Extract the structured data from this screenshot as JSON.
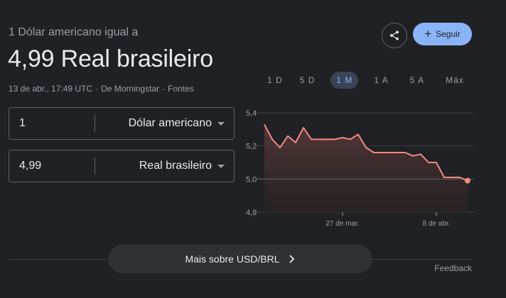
{
  "header": {
    "subtitle": "1 Dólar americano igual a",
    "value": "4,99 Real brasileiro",
    "timestamp": "13 de abr., 17:49 UTC",
    "source": "De Morningstar",
    "sources_link": "Fontes"
  },
  "actions": {
    "share_icon": "share-icon",
    "follow_label": "Seguir"
  },
  "converter": {
    "from": {
      "amount": "1",
      "currency": "Dólar americano"
    },
    "to": {
      "amount": "4,99",
      "currency": "Real brasileiro"
    }
  },
  "range_tabs": [
    {
      "label": "1 D",
      "active": false
    },
    {
      "label": "5 D",
      "active": false
    },
    {
      "label": "1 M",
      "active": true
    },
    {
      "label": "1 A",
      "active": false
    },
    {
      "label": "5 A",
      "active": false
    },
    {
      "label": "Máx",
      "active": false
    }
  ],
  "footer": {
    "more_label": "Mais sobre USD/BRL",
    "feedback_label": "Feedback"
  },
  "colors": {
    "line": "#f28b82",
    "accent": "#8ab4f8",
    "background": "#202124"
  },
  "chart_data": {
    "type": "area",
    "title": "",
    "xlabel": "",
    "ylabel": "",
    "ylim": [
      4.8,
      5.4
    ],
    "yticks": [
      "5,4",
      "5,2",
      "5,0",
      "4,8"
    ],
    "yticks_values": [
      5.4,
      5.2,
      5.0,
      4.8
    ],
    "xticks": [
      {
        "label": "27 de mar.",
        "index": 10
      },
      {
        "label": "8 de abr.",
        "index": 22
      }
    ],
    "reference_value": 5.0,
    "series": [
      {
        "values": [
          5.33,
          5.24,
          5.19,
          5.26,
          5.22,
          5.31,
          5.24,
          5.24,
          5.24,
          5.24,
          5.25,
          5.24,
          5.27,
          5.19,
          5.16,
          5.16,
          5.16,
          5.16,
          5.16,
          5.14,
          5.15,
          5.1,
          5.1,
          5.01,
          5.01,
          5.01,
          4.99
        ]
      }
    ]
  }
}
